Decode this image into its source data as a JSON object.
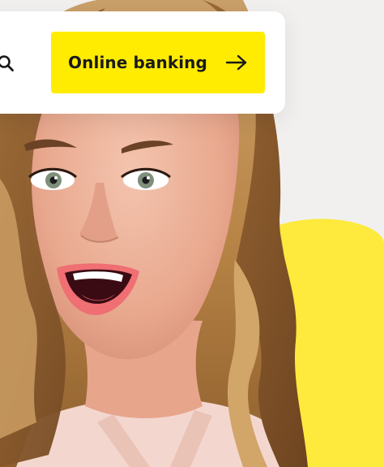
{
  "header": {
    "search_icon": "search-icon",
    "online_banking_label": "Online banking",
    "online_banking_icon": "arrow-right-icon"
  },
  "hero": {
    "image": "portrait-of-excited-woman",
    "accent_color": "#ffec00",
    "blob_color": "#fdea3d"
  }
}
